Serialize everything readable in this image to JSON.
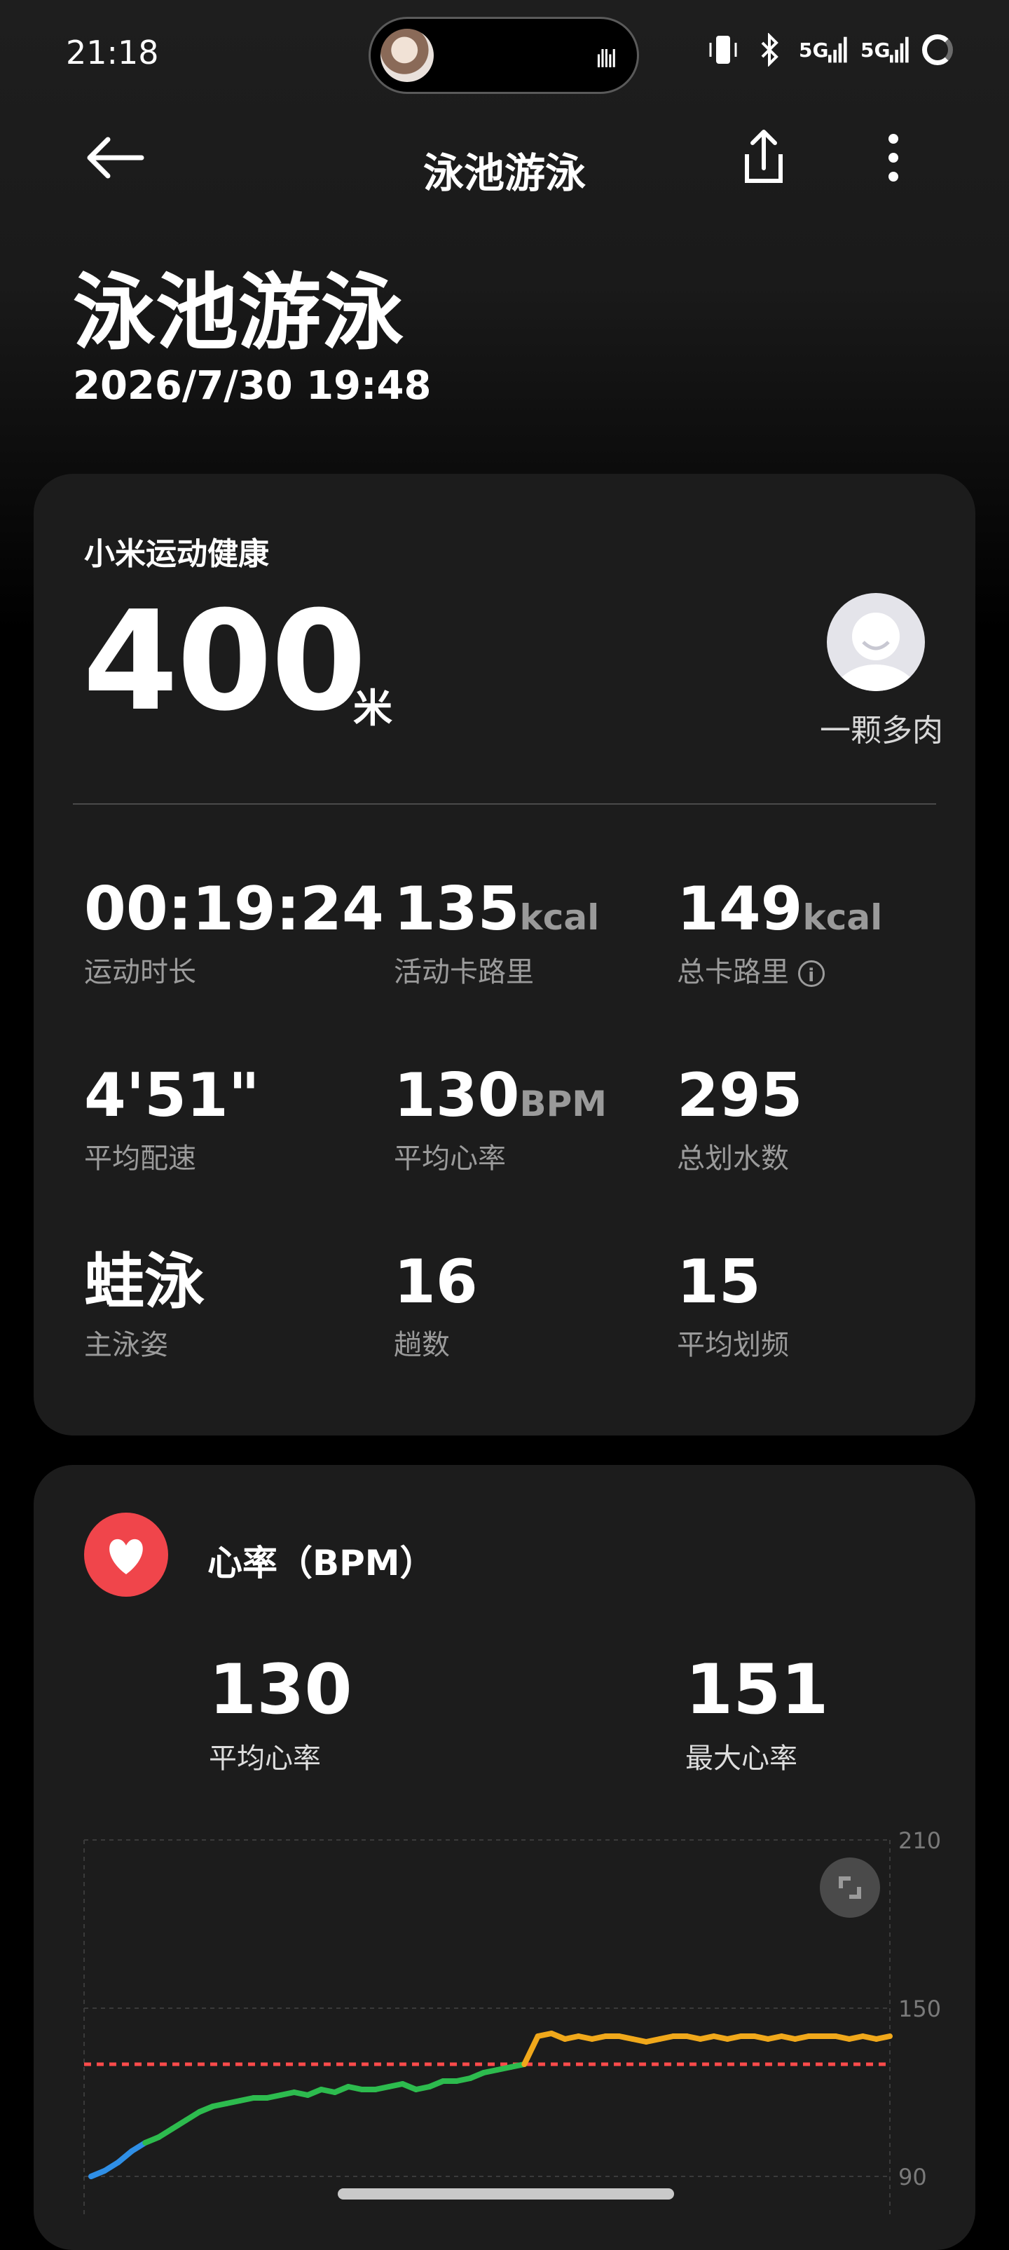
{
  "status_bar": {
    "time": "21:18",
    "icons": [
      "vibrate-icon",
      "bluetooth-icon",
      "signal-5g-icon",
      "signal-5g-icon",
      "battery-ring-icon"
    ],
    "sig1": "5G",
    "sig2": "5G"
  },
  "app_bar": {
    "title": "泳池游泳",
    "back_icon": "arrow-left-icon",
    "share_icon": "share-icon",
    "more_icon": "more-vertical-icon"
  },
  "hero": {
    "title": "泳池游泳",
    "datetime": "2026/7/30 19:48"
  },
  "summary": {
    "brand": "小米运动健康",
    "distance_value": "400",
    "distance_unit": "米",
    "user_name": "一颗多肉",
    "metrics": [
      {
        "value": "00:19:24",
        "unit": "",
        "label": "运动时长"
      },
      {
        "value": "135",
        "unit": "kcal",
        "label": "活动卡路里"
      },
      {
        "value": "149",
        "unit": "kcal",
        "label": "总卡路里"
      },
      {
        "value": "4'51\"",
        "unit": "",
        "label": "平均配速"
      },
      {
        "value": "130",
        "unit": "BPM",
        "label": "平均心率"
      },
      {
        "value": "295",
        "unit": "",
        "label": "总划水数"
      },
      {
        "value": "蛙泳",
        "unit": "",
        "label": "主泳姿"
      },
      {
        "value": "16",
        "unit": "",
        "label": "趟数"
      },
      {
        "value": "15",
        "unit": "",
        "label": "平均划频"
      }
    ]
  },
  "heart_rate": {
    "title": "心率（BPM）",
    "avg_value": "130",
    "avg_label": "平均心率",
    "max_value": "151",
    "max_label": "最大心率",
    "colors": {
      "icon_bg": "#f0454b",
      "zone_blue": "#2f8fe6",
      "zone_green": "#2dbb4e",
      "zone_orange": "#f0a81b",
      "avg_line": "#ff4b4b"
    }
  },
  "chart_data": {
    "type": "line",
    "title": "心率（BPM）",
    "y_ticks": [
      "210",
      "150",
      "90"
    ],
    "ylim": [
      90,
      210
    ],
    "avg_line": 130,
    "grid": true,
    "series": [
      {
        "values": [
          90,
          92,
          95,
          99,
          102,
          104,
          107,
          110,
          113,
          115,
          116,
          117,
          118,
          118,
          119,
          120,
          119,
          121,
          120,
          122,
          121,
          121,
          122,
          123,
          121,
          122,
          124,
          124,
          125,
          127,
          128,
          129,
          130,
          140,
          141,
          139,
          140,
          139,
          140,
          140,
          139,
          138,
          139,
          140,
          140,
          139,
          140,
          139,
          140,
          140,
          139,
          140,
          139,
          140,
          140,
          140,
          139,
          140,
          139,
          140
        ]
      }
    ]
  }
}
